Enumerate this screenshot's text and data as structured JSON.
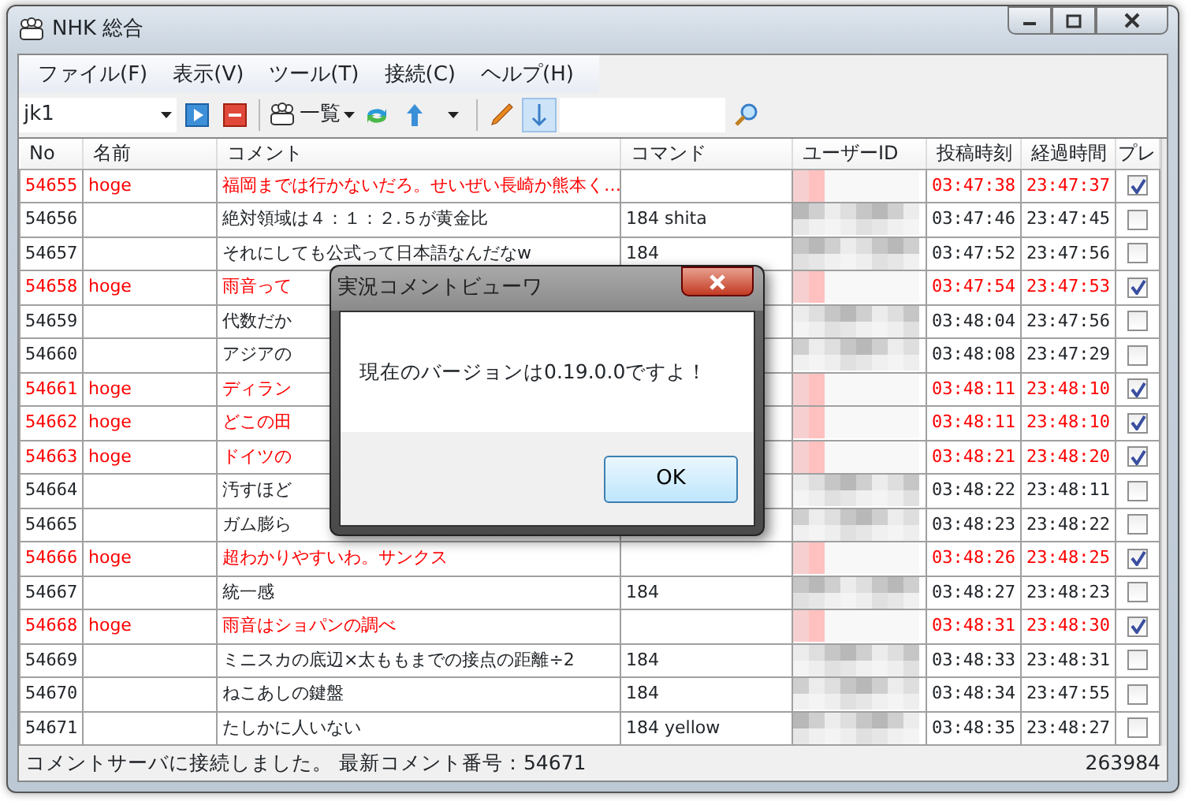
{
  "window": {
    "title": "NHK 総合"
  },
  "menu": [
    "ファイル(F)",
    "表示(V)",
    "ツール(T)",
    "接続(C)",
    "ヘルプ(H)"
  ],
  "toolbar": {
    "channel": "jk1",
    "list_label": "一覧",
    "scroll_down_pressed": true
  },
  "table": {
    "columns": [
      "No",
      "名前",
      "コメント",
      "コマンド",
      "ユーザーID",
      "投稿時刻",
      "経過時間",
      "プレ"
    ],
    "rows": [
      {
        "no": "54655",
        "name": "hoge",
        "comment": "福岡までは行かないだろ。せいぜい長崎か熊本く…",
        "command": "",
        "posted": "03:47:38",
        "elapsed": "23:47:37",
        "highlight": true,
        "checked": true
      },
      {
        "no": "54656",
        "name": "",
        "comment": "絶対領域は４：１：２.５が黄金比",
        "command": "184 shita",
        "posted": "03:47:46",
        "elapsed": "23:47:45",
        "highlight": false,
        "checked": false
      },
      {
        "no": "54657",
        "name": "",
        "comment": "それにしても公式って日本語なんだなw",
        "command": "184",
        "posted": "03:47:52",
        "elapsed": "23:47:56",
        "highlight": false,
        "checked": false
      },
      {
        "no": "54658",
        "name": "hoge",
        "comment": "雨音って",
        "command": "",
        "posted": "03:47:54",
        "elapsed": "23:47:53",
        "highlight": true,
        "checked": true
      },
      {
        "no": "54659",
        "name": "",
        "comment": "代数だか",
        "command": "",
        "posted": "03:48:04",
        "elapsed": "23:47:56",
        "highlight": false,
        "checked": false
      },
      {
        "no": "54660",
        "name": "",
        "comment": "アジアの",
        "command": "",
        "posted": "03:48:08",
        "elapsed": "23:47:29",
        "highlight": false,
        "checked": false
      },
      {
        "no": "54661",
        "name": "hoge",
        "comment": "ディラン",
        "command": "",
        "posted": "03:48:11",
        "elapsed": "23:48:10",
        "highlight": true,
        "checked": true
      },
      {
        "no": "54662",
        "name": "hoge",
        "comment": "どこの田",
        "command": "",
        "posted": "03:48:11",
        "elapsed": "23:48:10",
        "highlight": true,
        "checked": true
      },
      {
        "no": "54663",
        "name": "hoge",
        "comment": "ドイツの",
        "command": "",
        "posted": "03:48:21",
        "elapsed": "23:48:20",
        "highlight": true,
        "checked": true
      },
      {
        "no": "54664",
        "name": "",
        "comment": "汚すほど",
        "command": "",
        "posted": "03:48:22",
        "elapsed": "23:48:11",
        "highlight": false,
        "checked": false
      },
      {
        "no": "54665",
        "name": "",
        "comment": "ガム膨ら",
        "command": "",
        "posted": "03:48:23",
        "elapsed": "23:48:22",
        "highlight": false,
        "checked": false
      },
      {
        "no": "54666",
        "name": "hoge",
        "comment": "超わかりやすいわ。サンクス",
        "command": "",
        "posted": "03:48:26",
        "elapsed": "23:48:25",
        "highlight": true,
        "checked": true
      },
      {
        "no": "54667",
        "name": "",
        "comment": "統一感",
        "command": "184",
        "posted": "03:48:27",
        "elapsed": "23:48:23",
        "highlight": false,
        "checked": false
      },
      {
        "no": "54668",
        "name": "hoge",
        "comment": "雨音はショパンの調べ",
        "command": "",
        "posted": "03:48:31",
        "elapsed": "23:48:30",
        "highlight": true,
        "checked": true
      },
      {
        "no": "54669",
        "name": "",
        "comment": "ミニスカの底辺×太ももまでの接点の距離÷2",
        "command": "184",
        "posted": "03:48:33",
        "elapsed": "23:48:31",
        "highlight": false,
        "checked": false
      },
      {
        "no": "54670",
        "name": "",
        "comment": "ねこあしの鍵盤",
        "command": "184",
        "posted": "03:48:34",
        "elapsed": "23:47:55",
        "highlight": false,
        "checked": false
      },
      {
        "no": "54671",
        "name": "",
        "comment": "たしかに人いない",
        "command": "184 yellow",
        "posted": "03:48:35",
        "elapsed": "23:48:27",
        "highlight": false,
        "checked": false
      }
    ]
  },
  "status_bar": {
    "message": "コメントサーバに接続しました。 最新コメント番号：54671",
    "count": "263984"
  },
  "dialog": {
    "title": "実況コメントビューワ",
    "message": "現在のバージョンは0.19.0.0ですよ！",
    "button": "OK"
  }
}
